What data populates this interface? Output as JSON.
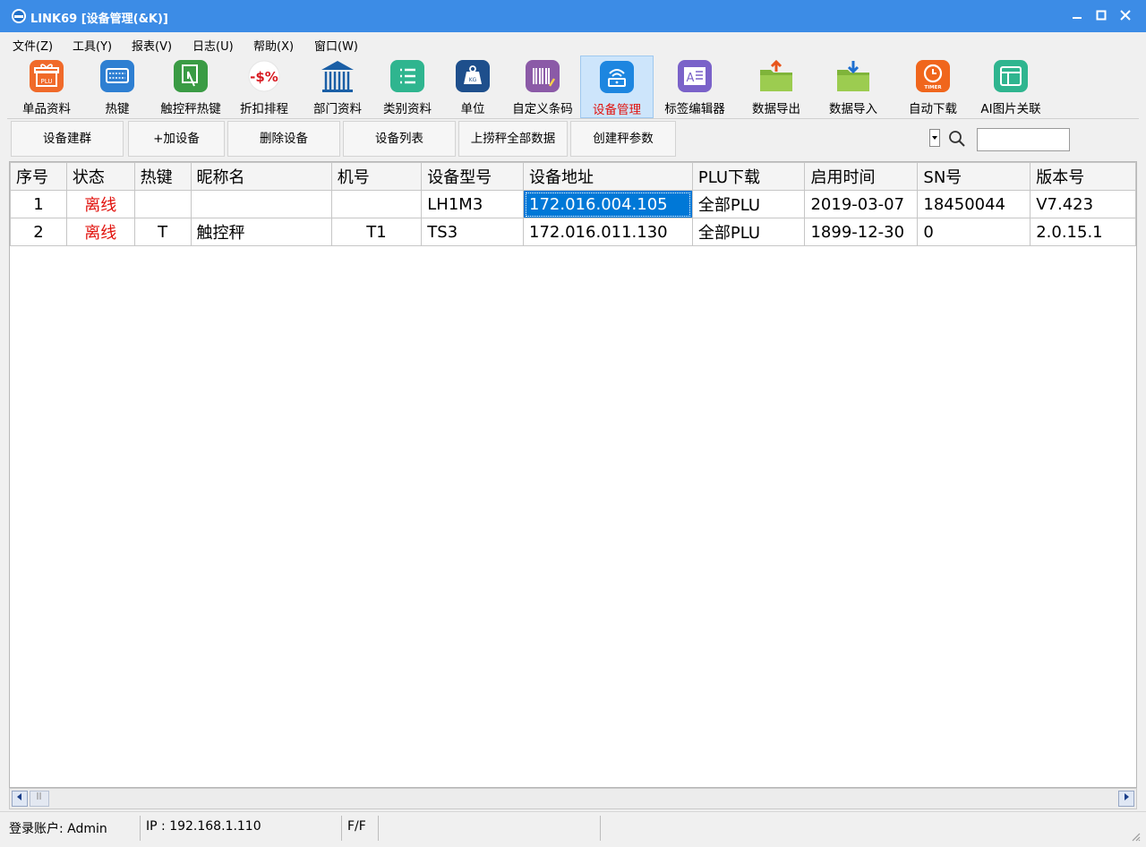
{
  "window": {
    "title": "LINK69 [设备管理(&K)]"
  },
  "menu": [
    "文件(Z)",
    "工具(Y)",
    "报表(V)",
    "日志(U)",
    "帮助(X)",
    "窗口(W)"
  ],
  "toolbar": [
    {
      "label": "单品资料",
      "icon": "plu-gift-icon"
    },
    {
      "label": "热键",
      "icon": "keyboard-icon"
    },
    {
      "label": "触控秤热键",
      "icon": "touch-scale-icon"
    },
    {
      "label": "折扣排程",
      "icon": "discount-icon",
      "icon_text": "-$%"
    },
    {
      "label": "部门资料",
      "icon": "bank-building-icon"
    },
    {
      "label": "类别资料",
      "icon": "list-icon"
    },
    {
      "label": "单位",
      "icon": "weight-unit-icon"
    },
    {
      "label": "自定义条码",
      "icon": "barcode-icon"
    },
    {
      "label": "设备管理",
      "icon": "router-icon",
      "active": true
    },
    {
      "label": "标签编辑器",
      "icon": "label-editor-icon"
    },
    {
      "label": "数据导出",
      "icon": "folder-export-icon"
    },
    {
      "label": "数据导入",
      "icon": "folder-import-icon"
    },
    {
      "label": "自动下载",
      "icon": "timer-icon",
      "icon_text": "TIMER"
    },
    {
      "label": "AI图片关联",
      "icon": "ai-image-icon"
    }
  ],
  "actions": [
    "设备建群",
    "+加设备",
    "删除设备",
    "设备列表",
    "上捞秤全部数据",
    "创建秤参数"
  ],
  "search": {
    "value": ""
  },
  "table": {
    "columns": [
      "序号",
      "状态",
      "热键",
      "昵称名",
      "机号",
      "设备型号",
      "设备地址",
      "PLU下载",
      "启用时间",
      "SN号",
      "版本号"
    ],
    "rows": [
      [
        "1",
        "离线",
        "",
        "",
        "",
        "LH1M3",
        "172.016.004.105",
        "全部PLU",
        "2019-03-07",
        "18450044",
        "V7.423"
      ],
      [
        "2",
        "离线",
        "T",
        "触控秤",
        "T1",
        "TS3",
        "172.016.011.130",
        "全部PLU",
        "1899-12-30",
        "0",
        "2.0.15.1"
      ]
    ]
  },
  "status": {
    "account": "登录账户: Admin",
    "ip": "IP : 192.168.1.110",
    "flag": "F/F"
  },
  "colors": {
    "titlebar": "#3c8ce6",
    "selection": "#0078d7",
    "offline": "#e1120d"
  }
}
